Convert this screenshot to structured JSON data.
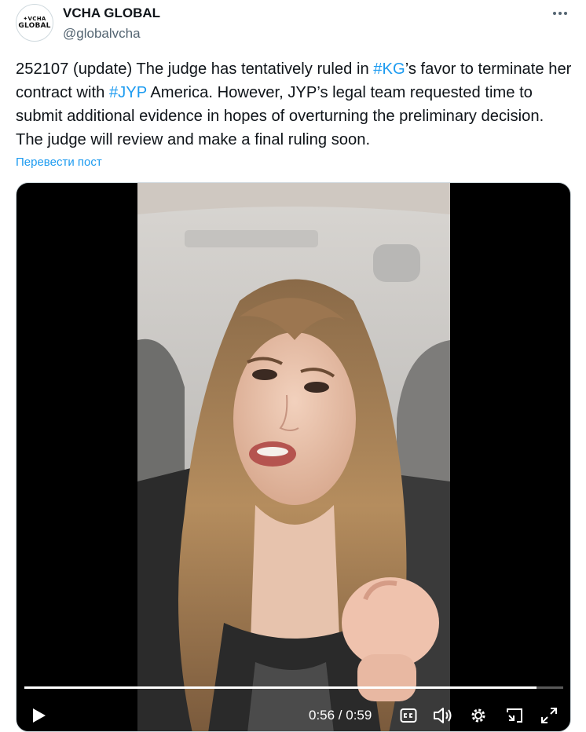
{
  "header": {
    "avatar_line1": "✦VCHA",
    "avatar_line2": "GLOBAL",
    "display_name": "VCHA GLOBAL",
    "handle": "@globalvcha",
    "more_icon": "more-horizontal-icon"
  },
  "tweet": {
    "text_1": "252107 (update) The judge has tentatively ruled in ",
    "hashtag_1": "#KG",
    "text_2": "’s favor to terminate her contract with ",
    "hashtag_2": "#JYP",
    "text_3": " America. However, JYP’s legal team requested time to submit additional evidence in hopes of overturning the preliminary decision. The judge will review and make a final ruling soon.",
    "translate_label": "Перевести пост"
  },
  "video": {
    "time_display": "0:56 / 0:59",
    "progress": 0.95,
    "icons": [
      "play-icon",
      "captions-icon",
      "volume-icon",
      "settings-icon",
      "pip-icon",
      "fullscreen-icon"
    ]
  },
  "colors": {
    "link": "#1d9bf0",
    "text": "#0f1419",
    "secondary": "#536471"
  }
}
